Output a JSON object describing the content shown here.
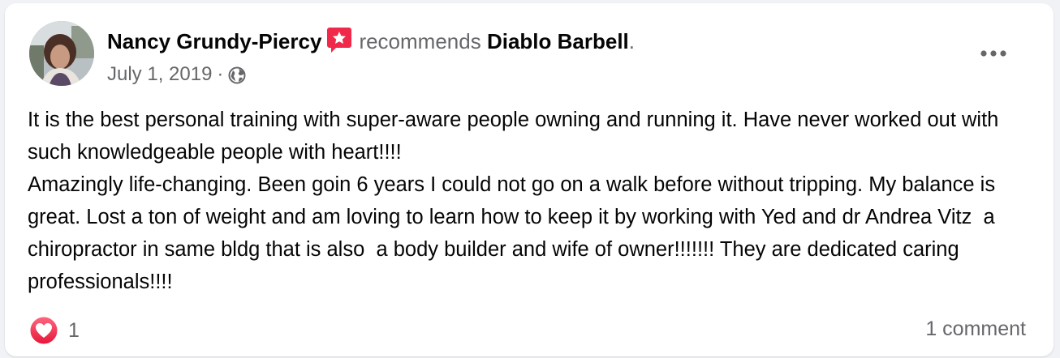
{
  "post": {
    "author_name": "Nancy Grundy-Piercy",
    "recommends_text": "recommends",
    "page_name": "Diablo Barbell",
    "page_suffix": ".",
    "date": "July 1, 2019",
    "separator": "·",
    "privacy_icon": "globe-icon",
    "badge_icon": "recommendation-star-icon",
    "more_icon": "more-options-icon",
    "body_paragraphs": [
      "It is the best personal training with super-aware people owning and running it. Have never worked out with such knowledgeable people with heart!!!!",
      "Amazingly life-changing. Been goin 6 years I could not go on a walk before without tripping. My balance is great. Lost a ton of weight and am loving to learn how to keep it by working with Yed and dr Andrea Vitz  a chiropractor in same bldg that is also  a body builder and wife of owner!!!!!!! They are dedicated caring professionals!!!!"
    ]
  },
  "reactions": {
    "icon": "love-reaction-icon",
    "count": "1"
  },
  "comments": {
    "label": "1 comment"
  },
  "colors": {
    "accent_badge": "#f02849",
    "secondary_text": "#65676b",
    "primary_text": "#050505",
    "card_bg": "#ffffff"
  }
}
